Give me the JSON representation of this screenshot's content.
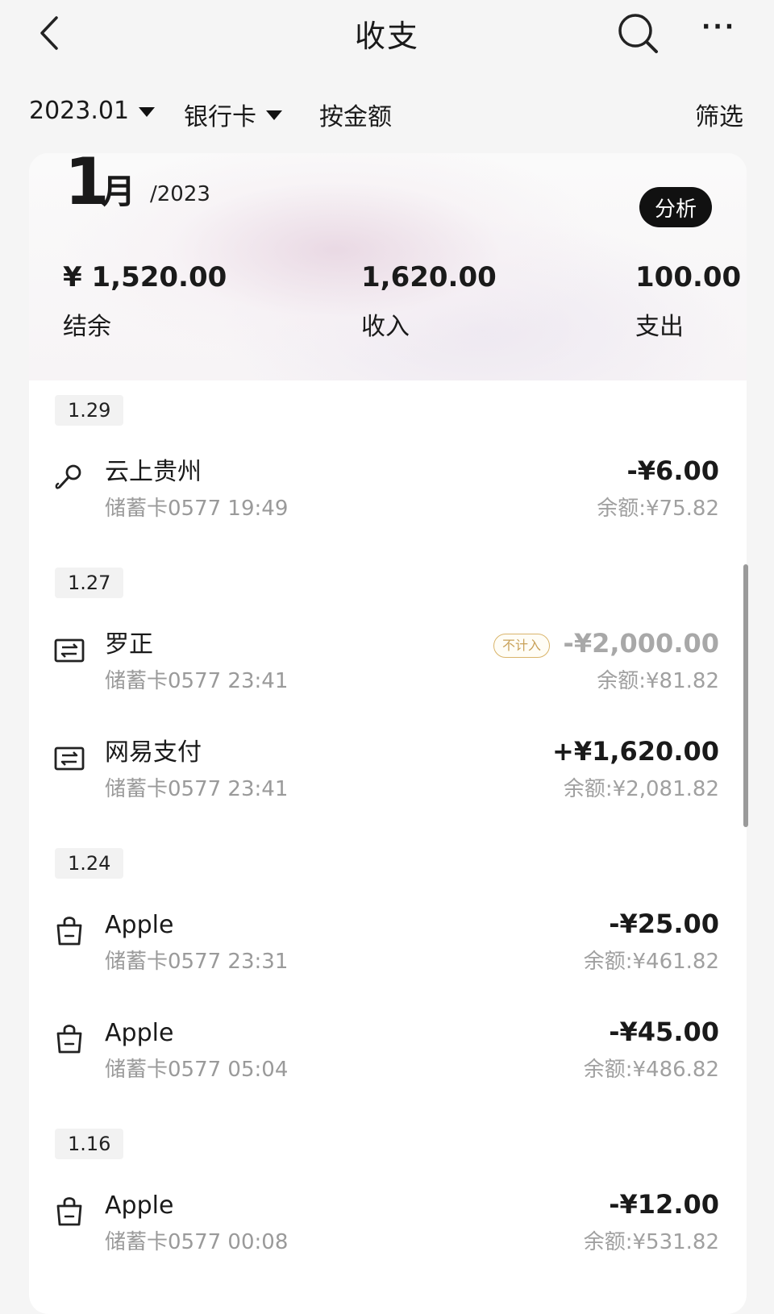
{
  "nav": {
    "title": "收支",
    "more": "···"
  },
  "filters": [
    {
      "label": "2023.01",
      "dropdown": true
    },
    {
      "label": "银行卡",
      "dropdown": true
    },
    {
      "label": "按金额",
      "dropdown": false
    }
  ],
  "filter_action": "筛选",
  "summary": {
    "month_number": "1",
    "month_unit": "月",
    "year": "/2023",
    "analyze_label": "分析",
    "balance": {
      "value": "¥ 1,520.00",
      "label": "结余"
    },
    "income": {
      "value": "1,620.00",
      "label": "收入"
    },
    "expense": {
      "value": "100.00",
      "label": "支出"
    }
  },
  "groups": [
    {
      "date": "1.29",
      "transactions": [
        {
          "icon": "microphone-icon",
          "name": "云上贵州",
          "sub": "储蓄卡0577 19:49",
          "amount": "-¥6.00",
          "balance": "余额:¥75.82"
        }
      ]
    },
    {
      "date": "1.27",
      "transactions": [
        {
          "icon": "transfer-icon",
          "name": "罗正",
          "sub": "储蓄卡0577 23:41",
          "amount": "-¥2,000.00",
          "balance": "余额:¥81.82",
          "tag": "不计入"
        },
        {
          "icon": "transfer-icon",
          "name": "网易支付",
          "sub": "储蓄卡0577 23:41",
          "amount": "+¥1,620.00",
          "balance": "余额:¥2,081.82"
        }
      ]
    },
    {
      "date": "1.24",
      "transactions": [
        {
          "icon": "shopping-bag-icon",
          "name": "Apple",
          "sub": "储蓄卡0577 23:31",
          "amount": "-¥25.00",
          "balance": "余额:¥461.82"
        },
        {
          "icon": "shopping-bag-icon",
          "name": "Apple",
          "sub": "储蓄卡0577 05:04",
          "amount": "-¥45.00",
          "balance": "余额:¥486.82"
        }
      ]
    },
    {
      "date": "1.16",
      "transactions": [
        {
          "icon": "shopping-bag-icon",
          "name": "Apple",
          "sub": "储蓄卡0577 00:08",
          "amount": "-¥12.00",
          "balance": "余额:¥531.82"
        }
      ]
    }
  ]
}
